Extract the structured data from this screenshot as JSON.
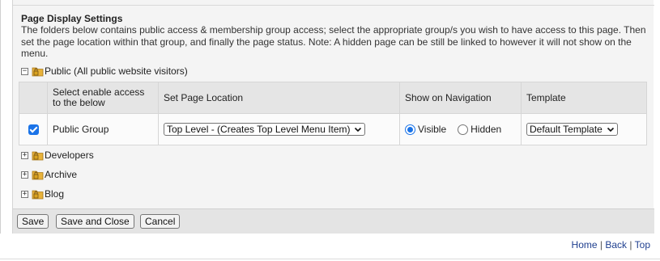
{
  "settings": {
    "title": "Page Display Settings",
    "description": "The folders below contains public access & membership group access; select the appropriate group/s you wish to have access to this page. Then set the page location within that group, and finally the page status. Note: A hidden page can be still be linked to however it will not show on the menu."
  },
  "tree": {
    "public": {
      "label": "Public (All public website visitors)",
      "toggle": "−",
      "expanded": true
    },
    "developers": {
      "label": "Developers",
      "toggle": "+"
    },
    "archive": {
      "label": "Archive",
      "toggle": "+"
    },
    "blog": {
      "label": "Blog",
      "toggle": "+"
    }
  },
  "table": {
    "headers": {
      "access": "Select enable access to the below",
      "location": "Set Page Location",
      "navigation": "Show on Navigation",
      "template": "Template"
    },
    "row": {
      "checked": true,
      "group": "Public Group",
      "location_selected": "Top Level - (Creates Top Level Menu Item)",
      "nav_visible_label": "Visible",
      "nav_hidden_label": "Hidden",
      "nav_selected": "Visible",
      "template_selected": "Default Template"
    }
  },
  "buttons": {
    "save": "Save",
    "save_close": "Save and Close",
    "cancel": "Cancel"
  },
  "footer": {
    "home": "Home",
    "back": "Back",
    "top": "Top",
    "separator": "|"
  },
  "colors": {
    "accent": "#1a73e8",
    "folder": "#e8b23a",
    "lock": "#6b4a12"
  },
  "icons": {
    "folder": "folder-lock-icon",
    "expand": "expand-icon",
    "collapse": "collapse-icon",
    "dropdown": "chevron-down-icon"
  }
}
